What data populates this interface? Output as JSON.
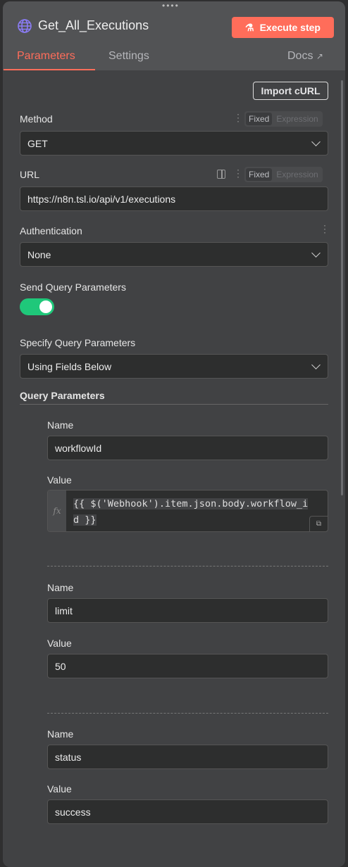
{
  "header": {
    "title": "Get_All_Executions",
    "execute_label": "Execute step",
    "tabs": [
      "Parameters",
      "Settings"
    ],
    "docs_label": "Docs"
  },
  "import_curl": "Import cURL",
  "method": {
    "label": "Method",
    "value": "GET",
    "modes": [
      "Fixed",
      "Expression"
    ]
  },
  "url": {
    "label": "URL",
    "value": "https://n8n.tsl.io/api/v1/executions",
    "modes": [
      "Fixed",
      "Expression"
    ]
  },
  "auth": {
    "label": "Authentication",
    "value": "None"
  },
  "send_query": {
    "label": "Send Query Parameters",
    "enabled": true
  },
  "specify_query": {
    "label": "Specify Query Parameters",
    "value": "Using Fields Below"
  },
  "query_params": {
    "label": "Query Parameters",
    "name_label": "Name",
    "value_label": "Value",
    "items": [
      {
        "name": "workflowId",
        "value": "{{ $('Webhook').item.json.body.workflow_id }}"
      },
      {
        "name": "limit",
        "value": "50"
      },
      {
        "name": "status",
        "value": "success"
      }
    ]
  },
  "colors": {
    "accent": "#ff6d5a",
    "toggle": "#1fc87a",
    "icon": "#8b7cf6"
  }
}
